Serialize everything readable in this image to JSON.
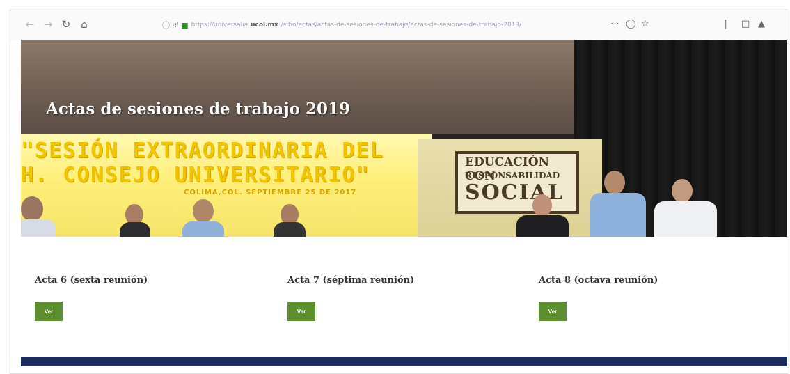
{
  "browser": {
    "url_prefix": "https://universalia",
    "url_domain": "ucol.mx",
    "url_path": "/sitio/actas/actas-de-sesiones-de-trabajo/actas-de-sesiones-de-trabajo-2019/",
    "icons": [
      "back-icon",
      "forward-icon",
      "reload-icon",
      "home-icon",
      "info-icon",
      "shield-icon",
      "lock-icon",
      "more-icon",
      "pocket-icon",
      "star-icon",
      "library-icon",
      "sidebar-icon",
      "extension-icon"
    ]
  },
  "hero": {
    "title": "Actas de sesiones de trabajo 2019",
    "banner_line1": "\"SESIÓN EXTRAORDINARIA DEL",
    "banner_line2": "H. CONSEJO UNIVERSITARIO\"",
    "banner_line3": "COLIMA,COL. SEPTIEMBRE 25 DE 2017",
    "sign_line1": "EDUCACIÓN CON",
    "sign_line2": "RESPONSABILIDAD",
    "sign_line3": "SOCIAL"
  },
  "actas": [
    {
      "title": "Acta 6 (sexta reunión)",
      "button": "Ver"
    },
    {
      "title": "Acta 7 (séptima reunión)",
      "button": "Ver"
    },
    {
      "title": "Acta 8 (octava reunión)",
      "button": "Ver"
    }
  ],
  "colors": {
    "button_green": "#5c8f2e",
    "footer_navy": "#1d2b5c"
  }
}
